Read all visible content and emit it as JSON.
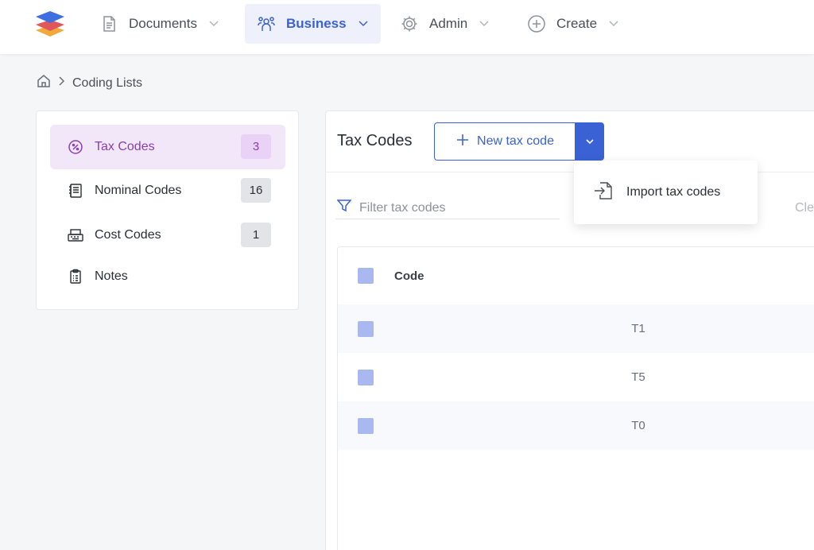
{
  "nav": {
    "items": [
      {
        "label": "Documents",
        "icon": "document-icon"
      },
      {
        "label": "Business",
        "icon": "team-icon",
        "active": true
      },
      {
        "label": "Admin",
        "icon": "gear-icon"
      },
      {
        "label": "Create",
        "icon": "plus-circle-icon"
      }
    ]
  },
  "breadcrumb": {
    "home_icon": "home-icon",
    "current": "Coding Lists"
  },
  "sidebar": {
    "items": [
      {
        "label": "Tax Codes",
        "count": "3",
        "icon": "tax-icon",
        "active": true
      },
      {
        "label": "Nominal Codes",
        "count": "16",
        "icon": "ledger-icon"
      },
      {
        "label": "Cost Codes",
        "count": "1",
        "icon": "cash-register-icon"
      },
      {
        "label": "Notes",
        "icon": "clipboard-icon"
      }
    ]
  },
  "main": {
    "title": "Tax Codes",
    "new_button_label": "New tax code",
    "filter_placeholder": "Filter tax codes",
    "clear_label": "Cle",
    "table": {
      "column_header": "Code",
      "rows": [
        "T1",
        "T5",
        "T0"
      ]
    },
    "menu": {
      "import_label": "Import tax codes"
    }
  },
  "colors": {
    "accent": "#3a62d4",
    "active_sidebar_bg": "#f1e7f8",
    "active_sidebar_text": "#8a3fb0",
    "checkbox": "#a9b8ee"
  }
}
